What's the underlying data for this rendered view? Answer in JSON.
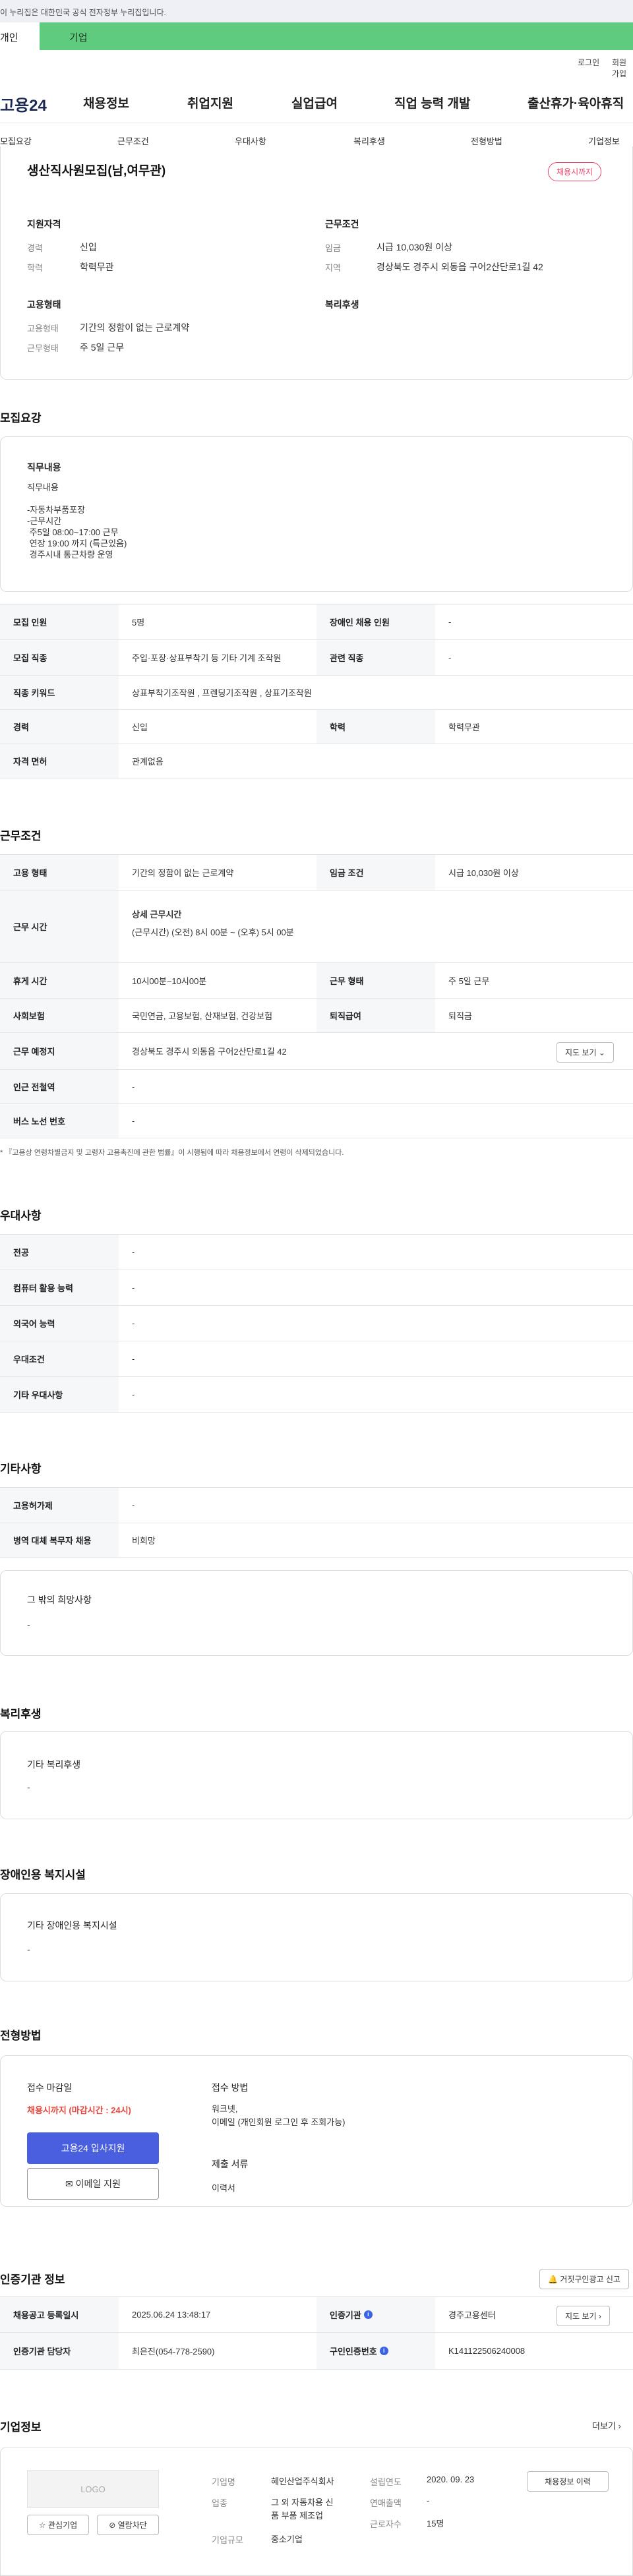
{
  "gov_banner": "이 누리집은 대한민국 공식 전자정부 누리집입니다.",
  "top_tabs": {
    "personal": "개인",
    "company": "기업"
  },
  "util": {
    "login": "로그인",
    "join": "회원가입"
  },
  "logo": "고용24",
  "gnb": [
    "채용정보",
    "취업지원",
    "실업급여",
    "직업 능력 개발",
    "출산휴가·육아휴직"
  ],
  "subnav": [
    "모집요강",
    "근무조건",
    "우대사항",
    "복리후생",
    "전형방법",
    "기업정보"
  ],
  "summary": {
    "title": "생산직사원모집(남,여무관)",
    "badge": "채용시까지",
    "qual_title": "지원자격",
    "exp_label": "경력",
    "exp_value": "신입",
    "edu_label": "학력",
    "edu_value": "학력무관",
    "cond_title": "근무조건",
    "wage_label": "임금",
    "wage_value": "시급 10,030원 이상",
    "area_label": "지역",
    "area_value": "경상북도 경주시 외동읍 구어2산단로1길 42",
    "emp_title": "고용형태",
    "emp_label": "고용형태",
    "emp_value": "기간의 정함이 없는 근로계약",
    "shape_label": "근무형태",
    "shape_value": "주 5일 근무",
    "welfare_title": "복리후생"
  },
  "recruit": {
    "section": "모집요강",
    "duty_title": "직무내용",
    "duty_lines": [
      "직무내용",
      "",
      "-자동차부품포장",
      "-근무시간",
      " 주5일 08:00~17:00 근무",
      " 연장 19:00 까지 (특근있음)",
      " 경주시내 통근차량 운영"
    ],
    "rows": [
      {
        "l1": "모집 인원",
        "v1": "5명",
        "l2": "장애인 채용 인원",
        "v2": "-"
      },
      {
        "l1": "모집 직종",
        "v1": "주입·포장·상표부착기 등 기타 기계 조작원",
        "l2": "관련 직종",
        "v2": "-"
      },
      {
        "l1": "직종 키워드",
        "v1": "상표부착기조작원 , 프렌딩기조작원 , 상표기조작원"
      },
      {
        "l1": "경력",
        "v1": "신입",
        "l2": "학력",
        "v2": "학력무관"
      },
      {
        "l1": "자격 면허",
        "v1": "관계없음"
      }
    ]
  },
  "work": {
    "section": "근무조건",
    "r1": {
      "l1": "고용 형태",
      "v1": "기간의 정함이 없는 근로계약",
      "l2": "임금 조건",
      "v2": "시급 10,030원 이상"
    },
    "r2": {
      "l1": "근무 시간",
      "head": "상세 근무시간",
      "v1": "(근무시간) (오전) 8시 00분 ~ (오후) 5시 00분"
    },
    "r3": {
      "l1": "휴게 시간",
      "v1": "10시00분~10시00분",
      "l2": "근무 형태",
      "v2": "주 5일 근무"
    },
    "r4": {
      "l1": "사회보험",
      "v1": "국민연금, 고용보험, 산재보험, 건강보험",
      "l2": "퇴직급여",
      "v2": "퇴직금"
    },
    "r5": {
      "l1": "근무 예정지",
      "v1": "경상북도 경주시 외동읍 구어2산단로1길 42",
      "btn": "지도 보기"
    },
    "r6": {
      "l1": "인근 전철역",
      "v1": "-"
    },
    "r7": {
      "l1": "버스 노선 번호",
      "v1": "-"
    },
    "note": "* 『고용상 연령차별금지 및 고령자 고용촉진에 관한 법률』이 시행됨에 따라 채용정보에서 연령이 삭제되었습니다."
  },
  "pref": {
    "section": "우대사항",
    "rows": [
      {
        "l": "전공",
        "v": "-"
      },
      {
        "l": "컴퓨터 활용 능력",
        "v": "-"
      },
      {
        "l": "외국어 능력",
        "v": "-"
      },
      {
        "l": "우대조건",
        "v": "-"
      },
      {
        "l": "기타 우대사항",
        "v": "-"
      }
    ]
  },
  "etc": {
    "section": "기타사항",
    "rows": [
      {
        "l": "고용허가제",
        "v": "-"
      },
      {
        "l": "병역 대체 복무자 채용",
        "v": "비희망"
      }
    ],
    "other_title": "그 밖의 희망사항",
    "other_value": "-"
  },
  "welfare": {
    "section": "복리후생",
    "title": "기타 복리후생",
    "value": "-"
  },
  "disabled": {
    "section": "장애인용 복지시설",
    "title": "기타 장애인용 복지시설",
    "value": "-"
  },
  "screening": {
    "section": "전형방법",
    "deadline_title": "접수 마감일",
    "deadline_value": "채용시까지 (마감시간 : 24시)",
    "apply_btn": "고용24 입사지원",
    "email_btn": "이메일 지원",
    "method_title": "접수 방법",
    "method_lines": [
      "워크넷,",
      "이메일 (개인회원 로그인 후 조회가능)"
    ],
    "docs_title": "제출 서류",
    "docs_value": "이력서"
  },
  "agency": {
    "section": "인증기관 정보",
    "report_btn": "거짓구인광고 신고",
    "r1": {
      "l1": "채용공고 등록일시",
      "v1": "2025.06.24 13:48:17",
      "l2": "인증기관",
      "v2": "경주고용센터",
      "btn": "지도 보기"
    },
    "r2": {
      "l1": "인증기관 담당자",
      "v1": "최은진(054-778-2590)",
      "l2": "구인인증번호",
      "v2": "K141122506240008"
    }
  },
  "company": {
    "section": "기업정보",
    "more": "더보기",
    "logo": "LOGO",
    "fav_btn": "관심기업",
    "block_btn": "열람차단",
    "name_label": "기업명",
    "name_value": "혜인산업주식회사",
    "biz_label": "업종",
    "biz_value": [
      "그 외 자동차용 신",
      "품 부품 제조업"
    ],
    "size_label": "기업규모",
    "size_value": "중소기업",
    "est_label": "설립연도",
    "est_value": "2020. 09. 23",
    "sales_label": "연매출액",
    "sales_value": "-",
    "emp_label": "근로자수",
    "emp_value": "15명",
    "jobs_btn": "채용정보 이력"
  }
}
